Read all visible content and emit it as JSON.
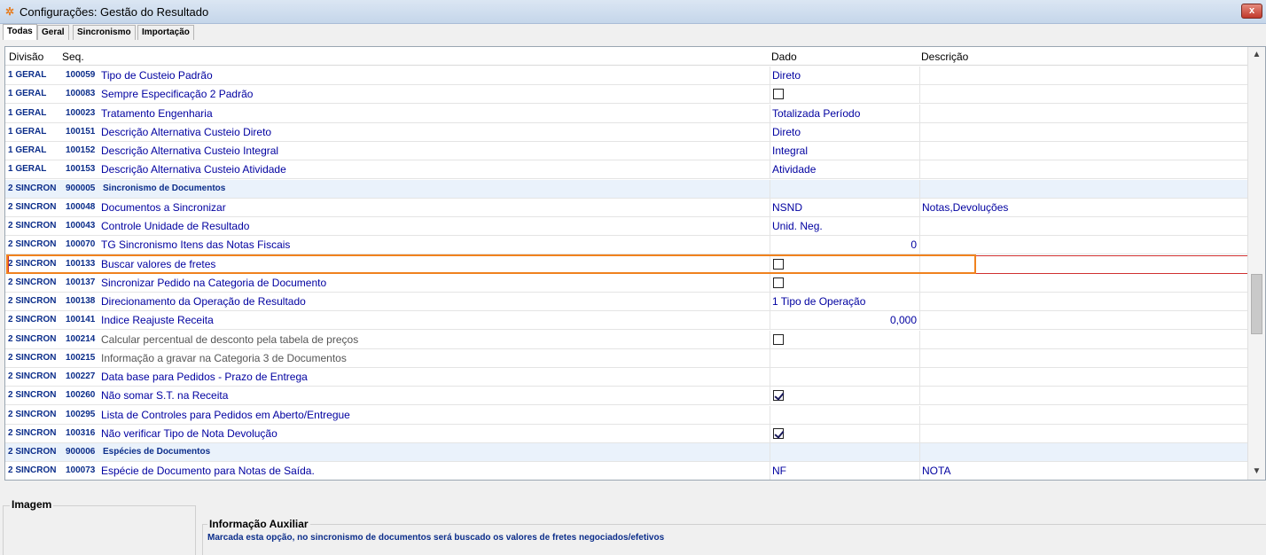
{
  "window": {
    "title": "Configurações: Gestão do Resultado",
    "close_label": "x"
  },
  "tabs": [
    {
      "label": "Todas",
      "active": true
    },
    {
      "label": "Geral",
      "active": false
    },
    {
      "label": "Sincronismo",
      "active": false
    },
    {
      "label": "Importação",
      "active": false
    }
  ],
  "grid": {
    "headers": {
      "divisao": "Divisão",
      "seq": "Seq.",
      "descricao": "",
      "dado": "Dado",
      "descricao2": "Descrição"
    },
    "rows": [
      {
        "div": "1 GERAL",
        "seq": "100059",
        "desc": "Tipo de Custeio Padrão",
        "dado": "Direto",
        "descr": ""
      },
      {
        "div": "1 GERAL",
        "seq": "100083",
        "desc": "Sempre Especificação 2 Padrão",
        "dado": "",
        "check": false,
        "descr": ""
      },
      {
        "div": "1 GERAL",
        "seq": "100023",
        "desc": "Tratamento Engenharia",
        "dado": "Totalizada Período",
        "descr": ""
      },
      {
        "div": "1 GERAL",
        "seq": "100151",
        "desc": "Descrição Alternativa Custeio Direto",
        "dado": "Direto",
        "descr": ""
      },
      {
        "div": "1 GERAL",
        "seq": "100152",
        "desc": "Descrição Alternativa Custeio Integral",
        "dado": "Integral",
        "descr": ""
      },
      {
        "div": "1 GERAL",
        "seq": "100153",
        "desc": "Descrição Alternativa Custeio Atividade",
        "dado": "Atividade",
        "descr": ""
      },
      {
        "div": "2 SINCRON",
        "seq": "900005",
        "desc": "Sincronismo de Documentos",
        "dado": "",
        "descr": "",
        "group": true
      },
      {
        "div": "2 SINCRON",
        "seq": "100048",
        "desc": "Documentos a Sincronizar",
        "dado": "NSND",
        "descr": "Notas,Devoluções"
      },
      {
        "div": "2 SINCRON",
        "seq": "100043",
        "desc": "Controle Unidade de Resultado",
        "dado": "Unid. Neg.",
        "descr": ""
      },
      {
        "div": "2 SINCRON",
        "seq": "100070",
        "desc": "TG Sincronismo Itens das Notas Fiscais",
        "dado": "0",
        "numeric": true,
        "descr": ""
      },
      {
        "div": "2 SINCRON",
        "seq": "100133",
        "desc": "Buscar valores de fretes",
        "dado": "",
        "check": false,
        "descr": "",
        "selected": true
      },
      {
        "div": "2 SINCRON",
        "seq": "100137",
        "desc": "Sincronizar Pedido na Categoria de Documento",
        "dado": "",
        "check": false,
        "descr": ""
      },
      {
        "div": "2 SINCRON",
        "seq": "100138",
        "desc": "Direcionamento da Operação de Resultado",
        "dado": "1 Tipo de Operação",
        "descr": ""
      },
      {
        "div": "2 SINCRON",
        "seq": "100141",
        "desc": "Indice Reajuste Receita",
        "dado": "0,000",
        "numeric": true,
        "descr": ""
      },
      {
        "div": "2 SINCRON",
        "seq": "100214",
        "desc": "Calcular percentual de desconto pela tabela de preços",
        "dado": "",
        "check": false,
        "descr": "",
        "dim": true
      },
      {
        "div": "2 SINCRON",
        "seq": "100215",
        "desc": "Informação a gravar na Categoria 3 de Documentos",
        "dado": "",
        "descr": "",
        "dim": true
      },
      {
        "div": "2 SINCRON",
        "seq": "100227",
        "desc": "Data base para Pedidos - Prazo de Entrega",
        "dado": "",
        "descr": ""
      },
      {
        "div": "2 SINCRON",
        "seq": "100260",
        "desc": "Não somar S.T. na Receita",
        "dado": "",
        "check": true,
        "descr": ""
      },
      {
        "div": "2 SINCRON",
        "seq": "100295",
        "desc": "Lista de Controles para Pedidos em Aberto/Entregue",
        "dado": "",
        "descr": ""
      },
      {
        "div": "2 SINCRON",
        "seq": "100316",
        "desc": "Não verificar Tipo de Nota Devolução",
        "dado": "",
        "check": true,
        "descr": ""
      },
      {
        "div": "2 SINCRON",
        "seq": "900006",
        "desc": "Espécies de Documentos",
        "dado": "",
        "descr": "",
        "group": true
      },
      {
        "div": "2 SINCRON",
        "seq": "100073",
        "desc": "Espécie de Documento para Notas de Saída.",
        "dado": "NF",
        "descr": "NOTA"
      }
    ]
  },
  "bottom": {
    "imagem_label": "Imagem",
    "info_label": "Informação Auxiliar",
    "info_text": "Marcada esta opção, no sincronismo de documentos será buscado os valores de fretes negociados/efetivos"
  },
  "colors": {
    "text_blue": "#0000a0",
    "highlight_orange": "#f0821e",
    "selection_red": "#d03030",
    "group_row_bg": "#eaf2fb"
  }
}
